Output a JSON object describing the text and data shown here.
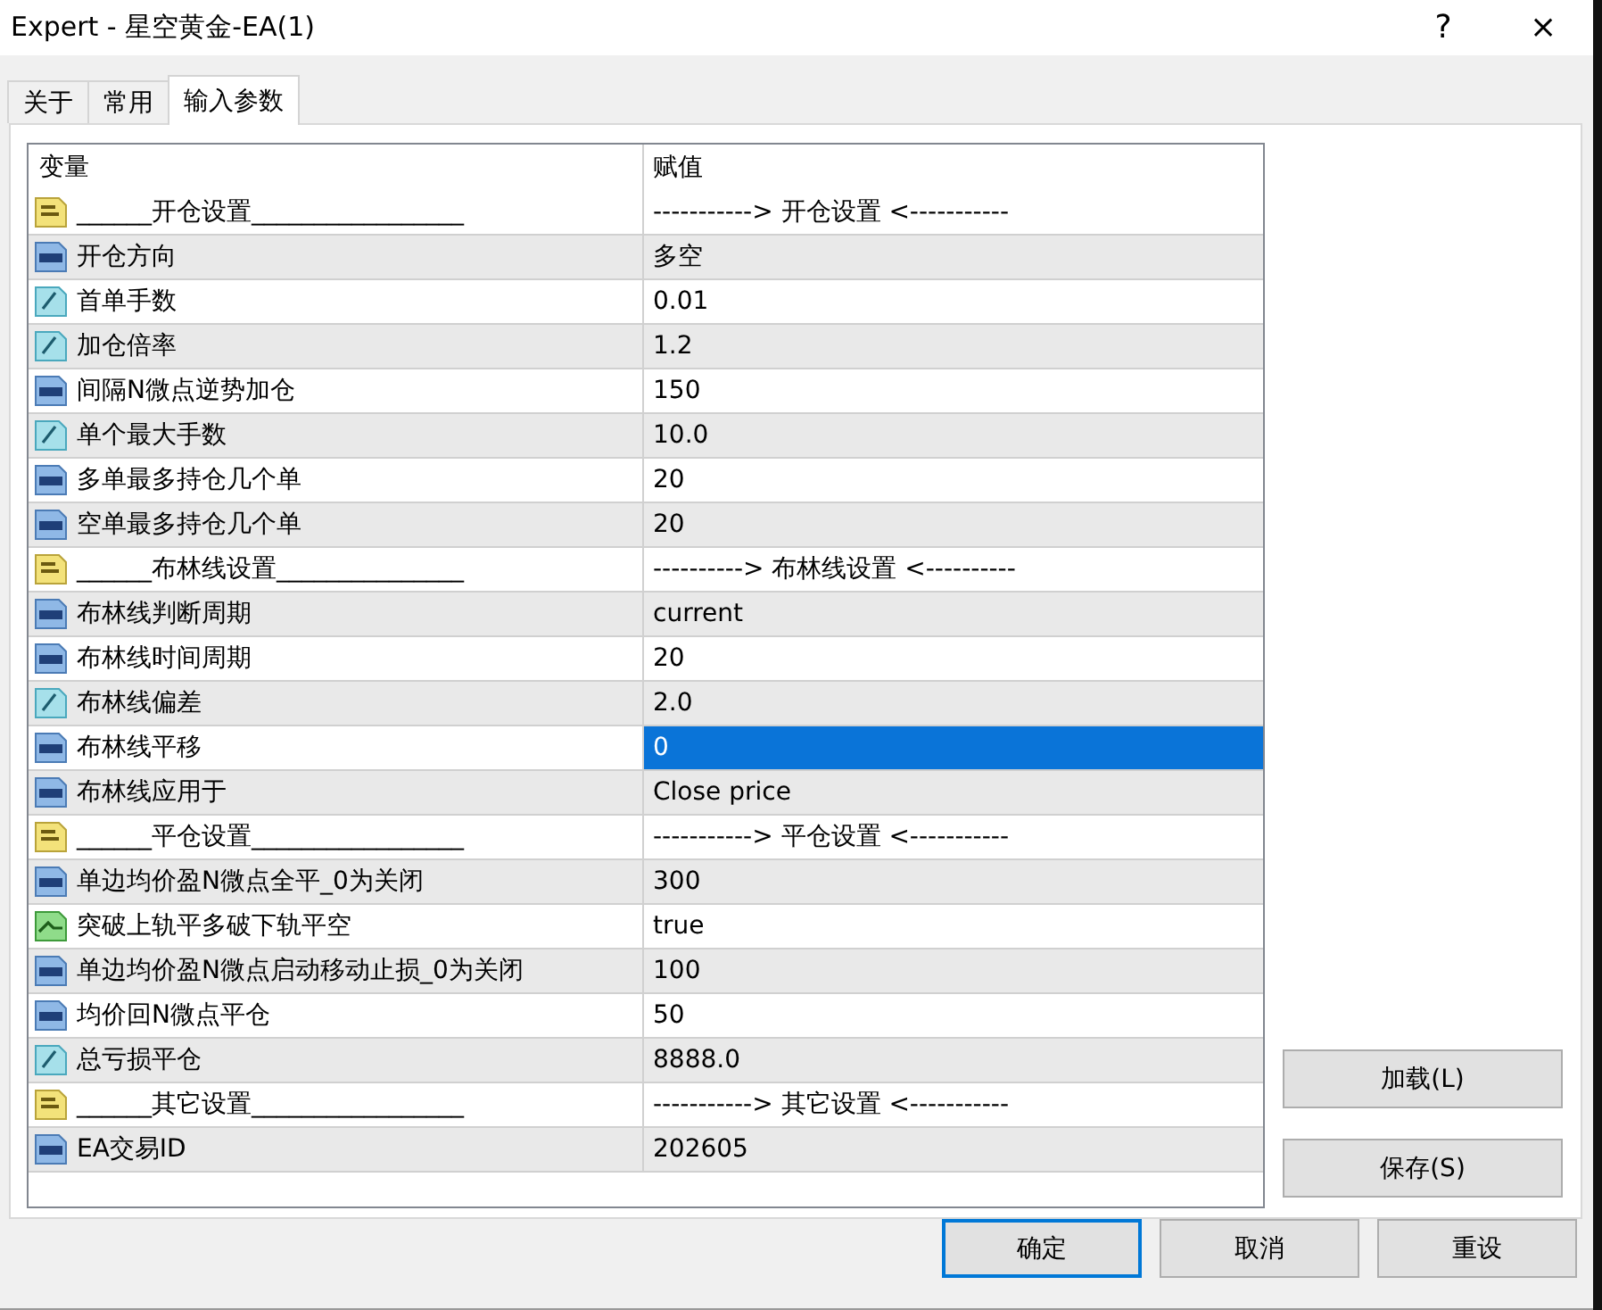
{
  "window": {
    "title": "Expert - 星空黄金-EA(1)",
    "help": "?",
    "close": "×"
  },
  "tabs": [
    {
      "label": "关于",
      "selected": false
    },
    {
      "label": "常用",
      "selected": false
    },
    {
      "label": "输入参数",
      "selected": true
    }
  ],
  "table": {
    "columns": [
      "变量",
      "赋值"
    ],
    "rows": [
      {
        "kind": "string",
        "name": "______开仓设置_________________",
        "value": "-----------> 开仓设置 <-----------",
        "selected": false
      },
      {
        "kind": "int",
        "name": "开仓方向",
        "value": "多空",
        "selected": false
      },
      {
        "kind": "double",
        "name": "首单手数",
        "value": "0.01",
        "selected": false
      },
      {
        "kind": "double",
        "name": "加仓倍率",
        "value": "1.2",
        "selected": false
      },
      {
        "kind": "int",
        "name": "间隔N微点逆势加仓",
        "value": "150",
        "selected": false
      },
      {
        "kind": "double",
        "name": "单个最大手数",
        "value": "10.0",
        "selected": false
      },
      {
        "kind": "int",
        "name": "多单最多持仓几个单",
        "value": "20",
        "selected": false
      },
      {
        "kind": "int",
        "name": "空单最多持仓几个单",
        "value": "20",
        "selected": false
      },
      {
        "kind": "string",
        "name": "______布林线设置_______________",
        "value": "----------> 布林线设置 <----------",
        "selected": false
      },
      {
        "kind": "int",
        "name": "布林线判断周期",
        "value": "current",
        "selected": false
      },
      {
        "kind": "int",
        "name": "布林线时间周期",
        "value": "20",
        "selected": false
      },
      {
        "kind": "double",
        "name": "布林线偏差",
        "value": "2.0",
        "selected": false
      },
      {
        "kind": "int",
        "name": "布林线平移",
        "value": "0",
        "selected": true
      },
      {
        "kind": "int",
        "name": "布林线应用于",
        "value": "Close price",
        "selected": false
      },
      {
        "kind": "string",
        "name": "______平仓设置_________________",
        "value": "-----------> 平仓设置 <-----------",
        "selected": false
      },
      {
        "kind": "int",
        "name": "单边均价盈N微点全平_0为关闭",
        "value": "300",
        "selected": false
      },
      {
        "kind": "bool",
        "name": "突破上轨平多破下轨平空",
        "value": "true",
        "selected": false
      },
      {
        "kind": "int",
        "name": "单边均价盈N微点启动移动止损_0为关闭",
        "value": "100",
        "selected": false
      },
      {
        "kind": "int",
        "name": "均价回N微点平仓",
        "value": "50",
        "selected": false
      },
      {
        "kind": "double",
        "name": "总亏损平仓",
        "value": "8888.0",
        "selected": false
      },
      {
        "kind": "string",
        "name": "______其它设置_________________",
        "value": "-----------> 其它设置 <-----------",
        "selected": false
      },
      {
        "kind": "int",
        "name": "EA交易ID",
        "value": "202605",
        "selected": false
      }
    ]
  },
  "side_buttons": [
    "加载(L)",
    "保存(S)"
  ],
  "buttons": [
    {
      "label": "确定",
      "default": true
    },
    {
      "label": "取消",
      "default": false
    },
    {
      "label": "重设",
      "default": false
    }
  ]
}
